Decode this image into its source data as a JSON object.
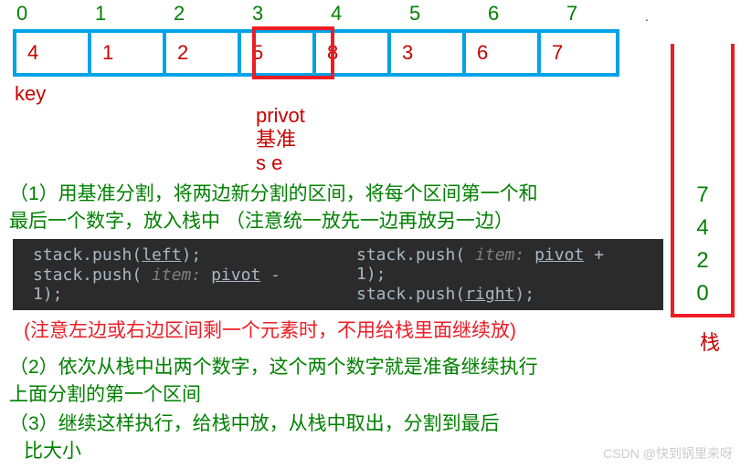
{
  "indices": [
    "0",
    "1",
    "2",
    "3",
    "4",
    "5",
    "6",
    "7"
  ],
  "array": [
    "4",
    "1",
    "2",
    "5",
    "8",
    "3",
    "6",
    "7"
  ],
  "key_label": "key",
  "pivot": {
    "label1": "privot",
    "label2": "基准",
    "label3": "s e"
  },
  "step1": {
    "line1": "（1）用基准分割，将两边新分割的区间，将每个区间第一个和",
    "line2": "最后一个数字，放入栈中 （注意统一放先一边再放另一边）"
  },
  "code": {
    "l1": "stack.push(",
    "left": "left",
    "semi": ");",
    "l2a": "stack.push( ",
    "item": "item: ",
    "pivot": "pivot",
    "minus": " - 1);",
    "r1": "stack.push( ",
    "pivot2": "pivot",
    "plus": " + 1);",
    "r2": "stack.push(",
    "right": "right",
    "semi2": ");"
  },
  "note_red": "(注意左边或右边区间剩一个元素时，不用给栈里面继续放)",
  "step2": {
    "line1": "（2）依次从栈中出两个数字，这个两个数字就是准备继续执行",
    "line2": "上面分割的第一个区间"
  },
  "step3": "（3）继续这样执行，给栈中放，从栈中取出，分割到最后",
  "compare": "比大小",
  "stack": {
    "items": [
      "7",
      "4",
      "2",
      "0"
    ],
    "label": "栈"
  },
  "watermark": "CSDN @快到锅里来呀"
}
